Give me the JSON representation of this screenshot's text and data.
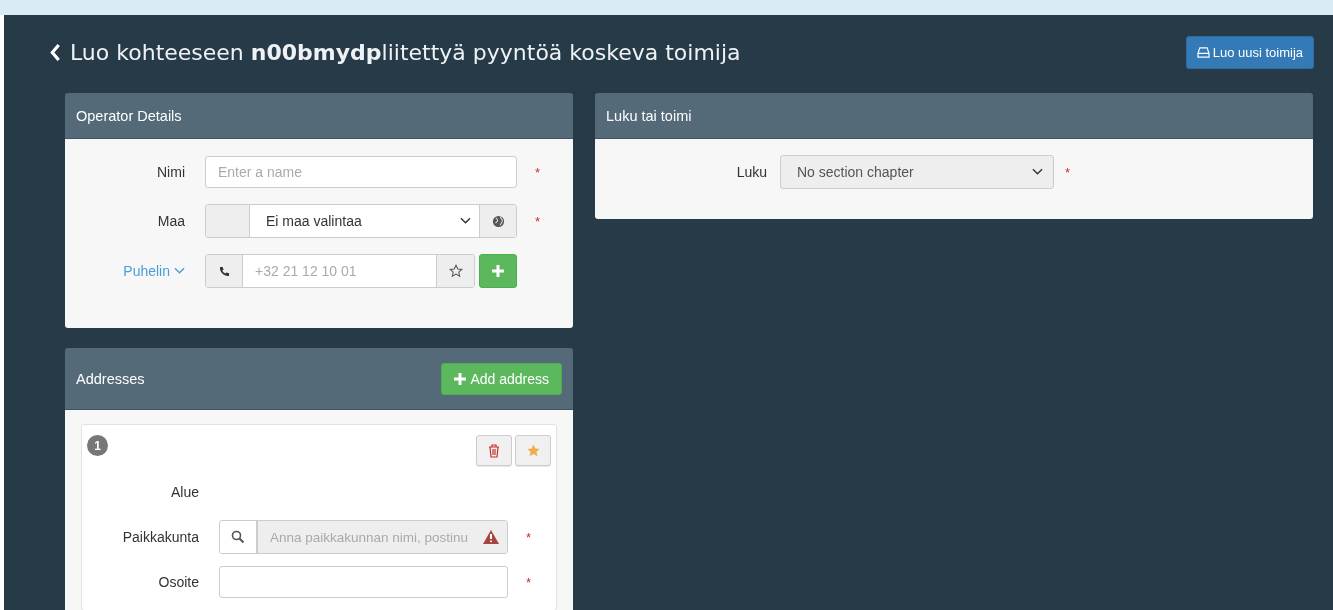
{
  "title": {
    "text": "Luo kohteeseen **n00bmydp**liitettyä pyyntöä koskeva toimija"
  },
  "create_button": {
    "label": "Luo uusi toimija"
  },
  "operator_details": {
    "title": "Operator Details",
    "fields": [
      {
        "kind": "text",
        "label": "Nimi",
        "placeholder": "Enter a name",
        "required_mark": "*"
      },
      {
        "kind": "country",
        "label": "Maa",
        "value": "Ei maa valintaa",
        "required_mark": "*"
      },
      {
        "kind": "phone",
        "label": "Puhelin",
        "placeholder": "+32 21 12 10 01"
      }
    ]
  },
  "addresses": {
    "title": "Addresses",
    "add_button": "Add address",
    "cards": [
      {
        "number": "1",
        "fields": [
          {
            "kind": "label",
            "label": "Alue"
          },
          {
            "kind": "search",
            "label": "Paikkakunta",
            "placeholder": "Anna paikkakunnan nimi, postinu",
            "disabled": true,
            "required_mark": "*"
          },
          {
            "kind": "text",
            "label": "Osoite",
            "required_mark": "*"
          }
        ]
      }
    ]
  },
  "chapter": {
    "title": "Luku tai toimi",
    "fields": [
      {
        "kind": "select",
        "label": "Luku",
        "value": "No section chapter",
        "required_mark": "*"
      }
    ]
  }
}
